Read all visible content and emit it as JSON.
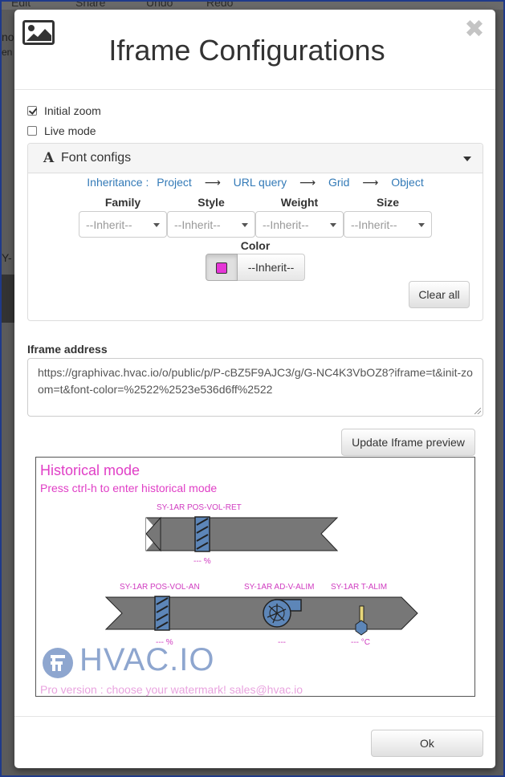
{
  "background": {
    "toolbar": [
      "Edit",
      "Share",
      "Undo",
      "Redo"
    ],
    "left_fragments": [
      "no",
      "en",
      "Y-"
    ]
  },
  "modal": {
    "title": "Iframe Configurations",
    "close_symbol": "✖"
  },
  "options": {
    "initial_zoom": {
      "label": "Initial zoom",
      "checked": true
    },
    "live_mode": {
      "label": "Live mode",
      "checked": false
    }
  },
  "font_configs": {
    "title": "Font configs",
    "inheritance_label": "Inheritance :",
    "inheritance": [
      "Project",
      "URL query",
      "Grid",
      "Object"
    ],
    "columns": [
      {
        "label": "Family",
        "value": "--Inherit--"
      },
      {
        "label": "Style",
        "value": "--Inherit--"
      },
      {
        "label": "Weight",
        "value": "--Inherit--"
      },
      {
        "label": "Size",
        "value": "--Inherit--"
      }
    ],
    "color_label": "Color",
    "color_value": "--Inherit--",
    "swatch_color": "#e536d6",
    "clear_all": "Clear all"
  },
  "iframe_address": {
    "label": "Iframe address",
    "value": "https://graphivac.hvac.io/o/public/p/P-cBZ5F9AJC3/g/G-NC4K3VbOZ8?iframe=t&init-zoom=t&font-color=%2522%2523e536d6ff%2522"
  },
  "update_button": "Update Iframe preview",
  "preview": {
    "title": "Historical mode",
    "subtitle": "Press ctrl-h to enter historical mode",
    "labels": {
      "ret": "SY-1AR POS-VOL-RET",
      "ret_value": "--- %",
      "an": "SY-1AR POS-VOL-AN",
      "an_value": "--- %",
      "alim": "SY-1AR AD-V-ALIM",
      "alim_value": "---",
      "talim": "SY-1AR T-ALIM",
      "talim_value": "--- °C"
    },
    "logo": "HVAC.IO",
    "watermark_note": "Pro version : choose your watermark! sales@hvac.io",
    "accent_color": "#e03ec6"
  },
  "ok_button": "Ok"
}
